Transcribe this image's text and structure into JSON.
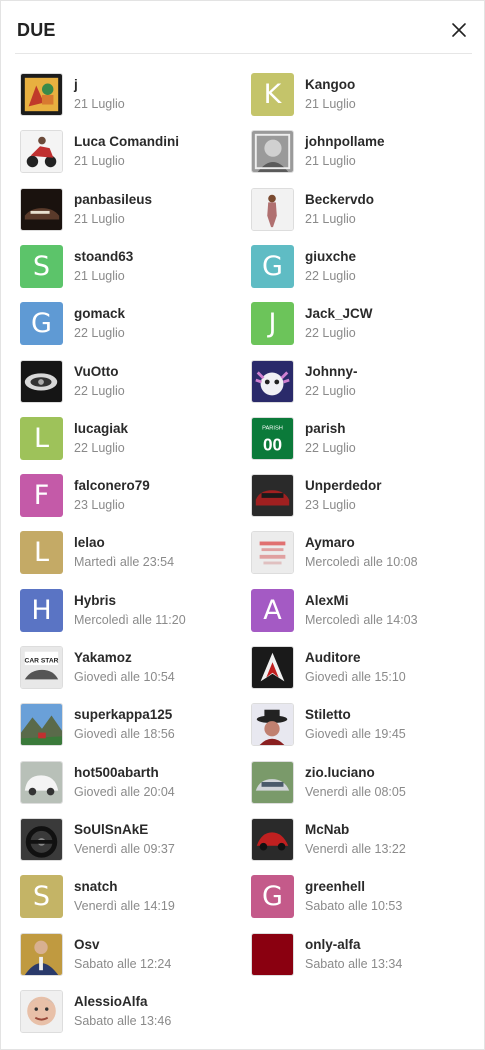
{
  "dialog": {
    "title": "DUE",
    "close_icon": "close-icon"
  },
  "users": [
    {
      "name": "j",
      "date": "21 Luglio",
      "avatar": "photo",
      "photo": "art",
      "color": "#a6502a"
    },
    {
      "name": "Kangoo",
      "date": "21 Luglio",
      "avatar": "letter",
      "letter": "K",
      "color": "#c4c46a"
    },
    {
      "name": "Luca Comandini",
      "date": "21 Luglio",
      "avatar": "photo",
      "photo": "scooter",
      "color": "#c03030"
    },
    {
      "name": "johnpollame",
      "date": "21 Luglio",
      "avatar": "photo",
      "photo": "portrait-bw",
      "color": "#888888"
    },
    {
      "name": "panbasileus",
      "date": "21 Luglio",
      "avatar": "photo",
      "photo": "car-dark",
      "color": "#3a2218"
    },
    {
      "name": "Beckervdo",
      "date": "21 Luglio",
      "avatar": "photo",
      "photo": "woman",
      "color": "#b07070"
    },
    {
      "name": "stoand63",
      "date": "21 Luglio",
      "avatar": "letter",
      "letter": "S",
      "color": "#5cc46a"
    },
    {
      "name": "giuxche",
      "date": "22 Luglio",
      "avatar": "letter",
      "letter": "G",
      "color": "#5fbcc4"
    },
    {
      "name": "gomack",
      "date": "22 Luglio",
      "avatar": "letter",
      "letter": "G",
      "color": "#5f9ad4"
    },
    {
      "name": "Jack_JCW",
      "date": "22 Luglio",
      "avatar": "letter",
      "letter": "J",
      "color": "#6cc45a"
    },
    {
      "name": "VuOtto",
      "date": "22 Luglio",
      "avatar": "photo",
      "photo": "wheel",
      "color": "#202020"
    },
    {
      "name": "Johnny-",
      "date": "22 Luglio",
      "avatar": "photo",
      "photo": "axolotl",
      "color": "#3a3a8a"
    },
    {
      "name": "lucagiak",
      "date": "22 Luglio",
      "avatar": "letter",
      "letter": "L",
      "color": "#9ec25a"
    },
    {
      "name": "parish",
      "date": "22 Luglio",
      "avatar": "photo",
      "photo": "jersey",
      "color": "#0b7a3a",
      "jersey_text": "PARISH",
      "jersey_number": "00"
    },
    {
      "name": "falconero79",
      "date": "23 Luglio",
      "avatar": "letter",
      "letter": "F",
      "color": "#c45aa8"
    },
    {
      "name": "Unperdedor",
      "date": "23 Luglio",
      "avatar": "photo",
      "photo": "car-red",
      "color": "#a02020"
    },
    {
      "name": "lelao",
      "date": "Martedì alle 23:54",
      "avatar": "letter",
      "letter": "L",
      "color": "#c4aa66"
    },
    {
      "name": "Aymaro",
      "date": "Mercoledì alle 10:08",
      "avatar": "photo",
      "photo": "placeholder",
      "color": "#d8d8d8"
    },
    {
      "name": "Hybris",
      "date": "Mercoledì alle 11:20",
      "avatar": "letter",
      "letter": "H",
      "color": "#5a74c4"
    },
    {
      "name": "AlexMi",
      "date": "Mercoledì alle 14:03",
      "avatar": "letter",
      "letter": "A",
      "color": "#a45ac4"
    },
    {
      "name": "Yakamoz",
      "date": "Giovedì alle 10:54",
      "avatar": "photo",
      "photo": "carstar",
      "color": "#333333",
      "badge_text": "CAR STAR"
    },
    {
      "name": "Auditore",
      "date": "Giovedì alle 15:10",
      "avatar": "photo",
      "photo": "assassin",
      "color": "#1a1a1a"
    },
    {
      "name": "superkappa125",
      "date": "Giovedì alle 18:56",
      "avatar": "photo",
      "photo": "mountain",
      "color": "#4a7ab0"
    },
    {
      "name": "Stiletto",
      "date": "Giovedì alle 19:45",
      "avatar": "photo",
      "photo": "hat",
      "color": "#603030"
    },
    {
      "name": "hot500abarth",
      "date": "Giovedì alle 20:04",
      "avatar": "photo",
      "photo": "car-white",
      "color": "#d0d0d0"
    },
    {
      "name": "zio.luciano",
      "date": "Venerdì alle 08:05",
      "avatar": "photo",
      "photo": "car-silver",
      "color": "#7a8a7a"
    },
    {
      "name": "SoUlSnAkE",
      "date": "Venerdì alle 09:37",
      "avatar": "photo",
      "photo": "steering",
      "color": "#2a2a2a"
    },
    {
      "name": "McNab",
      "date": "Venerdì alle 13:22",
      "avatar": "photo",
      "photo": "car-red2",
      "color": "#c02020"
    },
    {
      "name": "snatch",
      "date": "Venerdì alle 14:19",
      "avatar": "letter",
      "letter": "S",
      "color": "#c4b466"
    },
    {
      "name": "greenhell",
      "date": "Sabato alle 10:53",
      "avatar": "letter",
      "letter": "G",
      "color": "#c45a8a"
    },
    {
      "name": "Osv",
      "date": "Sabato alle 12:24",
      "avatar": "photo",
      "photo": "man-suit",
      "color": "#2a3a6a"
    },
    {
      "name": "only-alfa",
      "date": "Sabato alle 13:34",
      "avatar": "photo",
      "photo": "solid",
      "color": "#8a0010"
    },
    {
      "name": "AlessioAlfa",
      "date": "Sabato alle 13:46",
      "avatar": "photo",
      "photo": "face",
      "color": "#e8c0a8"
    }
  ]
}
